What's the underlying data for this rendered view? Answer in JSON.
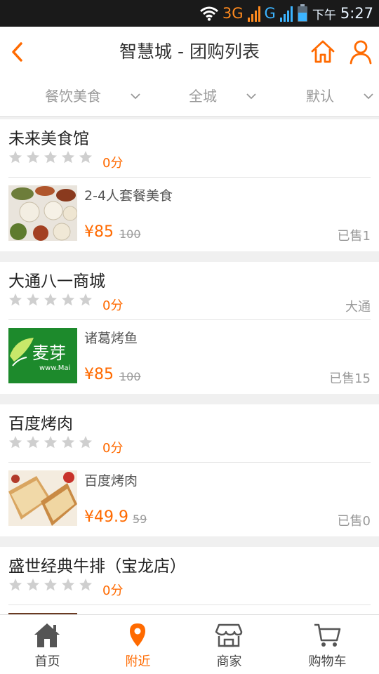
{
  "status_bar": {
    "network_1": "3G",
    "network_2": "G",
    "ampm": "下午",
    "time": "5:27",
    "colors": {
      "orange": "#ff8a1e",
      "blue": "#3cb4ff"
    }
  },
  "header": {
    "title": "智慧城 - 团购列表",
    "accent": "#ff6a00"
  },
  "filters": [
    {
      "label": "餐饮美食"
    },
    {
      "label": "全城"
    },
    {
      "label": "默认"
    }
  ],
  "deals": [
    {
      "shop": "未来美食馆",
      "score": "0分",
      "area": "",
      "title": "2-4人套餐美食",
      "price": "¥85",
      "old_price": "100",
      "sold": "已售1",
      "thumb": "food-platter"
    },
    {
      "shop": "大通八一商城",
      "score": "0分",
      "area": "大通",
      "title": "诸葛烤鱼",
      "price": "¥85",
      "old_price": "100",
      "sold": "已售15",
      "thumb": "maiya-logo",
      "thumb_text": "麦芽",
      "thumb_sub": "www.Mai"
    },
    {
      "shop": "百度烤肉",
      "score": "0分",
      "area": "",
      "title": "百度烤肉",
      "price": "¥49.9",
      "old_price": "59",
      "sold": "已售0",
      "thumb": "grilled-sandwich"
    },
    {
      "shop": "盛世经典牛排（宝龙店）",
      "score": "0分",
      "area": "",
      "title": "",
      "price": "",
      "old_price": "",
      "sold": "",
      "thumb": "steak"
    }
  ],
  "tabs": [
    {
      "label": "首页",
      "icon": "home-icon",
      "active": false
    },
    {
      "label": "附近",
      "icon": "location-pin-icon",
      "active": true
    },
    {
      "label": "商家",
      "icon": "store-icon",
      "active": false
    },
    {
      "label": "购物车",
      "icon": "cart-icon",
      "active": false
    }
  ]
}
